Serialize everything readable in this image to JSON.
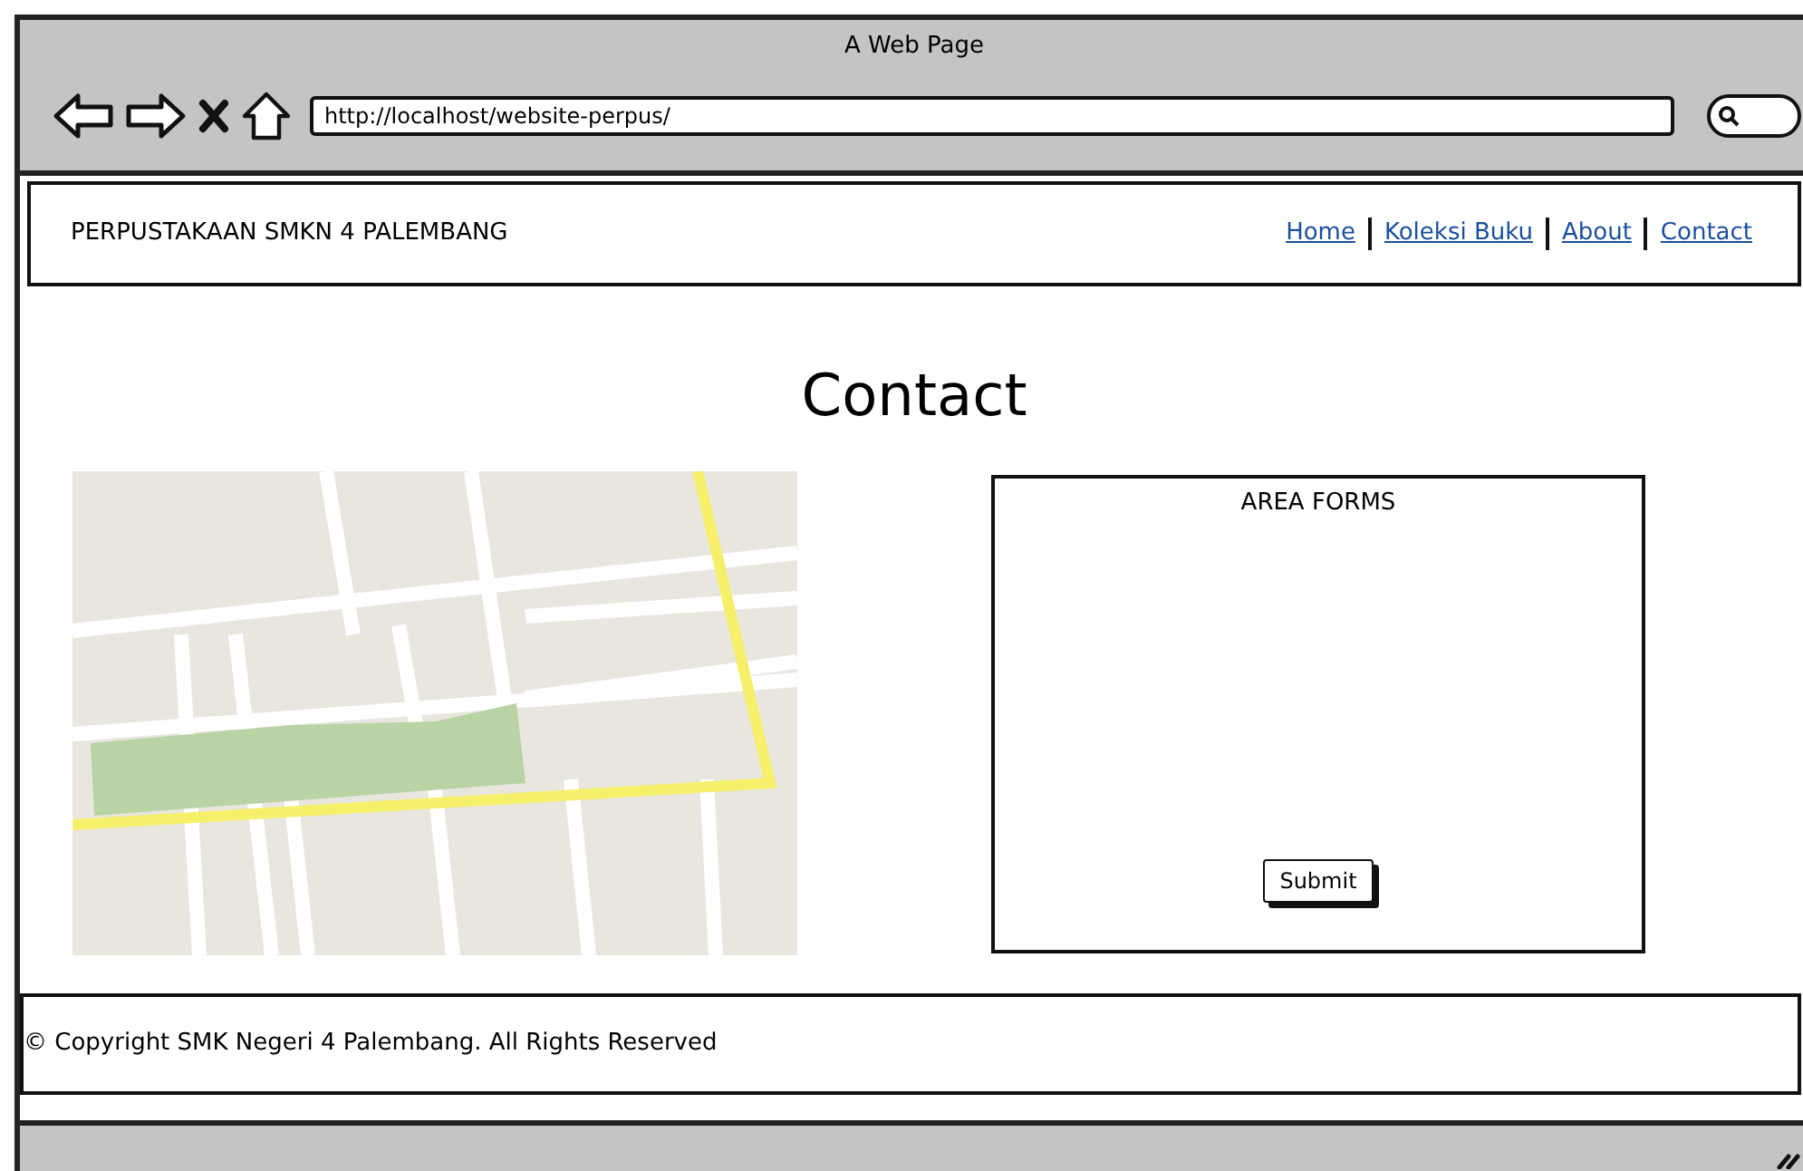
{
  "window": {
    "title": "A Web Page"
  },
  "browser": {
    "url": "http://localhost/website-perpus/"
  },
  "navbar": {
    "brand": "PERPUSTAKAAN SMKN 4 PALEMBANG",
    "links": [
      {
        "label": "Home"
      },
      {
        "label": "Koleksi Buku"
      },
      {
        "label": "About"
      },
      {
        "label": "Contact"
      }
    ]
  },
  "page": {
    "heading": "Contact",
    "form": {
      "title": "AREA FORMS",
      "submit": "Submit"
    }
  },
  "footer": {
    "text": "© Copyright SMK Negeri 4 Palembang. All Rights Reserved"
  }
}
